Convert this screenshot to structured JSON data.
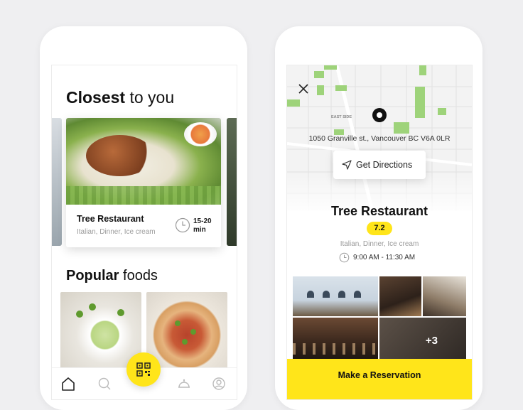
{
  "left_phone": {
    "closest": {
      "bold": "Closest",
      "rest": " to you"
    },
    "restaurant_card": {
      "name": "Tree Restaurant",
      "tags": "Italian, Dinner, Ice cream",
      "time_line1": "15-20",
      "time_line2": "min"
    },
    "popular": {
      "bold": "Popular",
      "rest": " foods"
    },
    "tabbar": {
      "icons": [
        "home-icon",
        "search-icon",
        "qr-code-icon",
        "cloche-icon",
        "profile-icon"
      ]
    }
  },
  "right_phone": {
    "map": {
      "address": "1050 Granville st., Vancouver BC V6A 0LR",
      "labels": [
        "EAST SIDE"
      ],
      "directions_label": "Get Directions"
    },
    "restaurant": {
      "name": "Tree Restaurant",
      "rating": "7.2",
      "tags": "Italian, Dinner, Ice cream",
      "hours": "9:00 AM - 11:30 AM"
    },
    "gallery": {
      "more_count": "+3"
    },
    "reserve_label": "Make a Reservation"
  },
  "colors": {
    "accent": "#ffe51a",
    "background": "#efeff1",
    "map_green": "#9ed37a"
  }
}
